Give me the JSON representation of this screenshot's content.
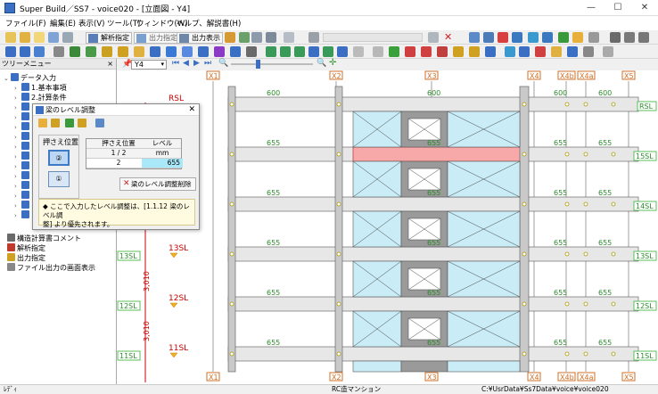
{
  "window": {
    "title": "Super Build／SS7 - voice020 - [立面図 - Y4]",
    "controls": [
      "—",
      "☐",
      "✕"
    ]
  },
  "menu": [
    "ファイル(F)",
    "編集(E)",
    "表示(V)",
    "ツール(T)",
    "ウィンドウ(W)",
    "ヘルプ、解説書(H)"
  ],
  "toolbar1": {
    "analysis_label": "解析指定",
    "output_spec_label": "出力指定",
    "output_display_label": "出力表示"
  },
  "tree": {
    "header": "ツリーメニュー",
    "close": "×",
    "items": [
      "データ入力",
      "1.基本事項",
      "2.計算条件"
    ],
    "bottom_items": [
      "構造計算書コメント",
      "解析指定",
      "出力指定",
      "ファイル出力の画面表示"
    ]
  },
  "level_toolbar": {
    "frame_select": "Y4"
  },
  "grid_labels": {
    "x_axes": [
      "X1",
      "X2",
      "X3",
      "X4",
      "X4b",
      "X4a",
      "X5"
    ]
  },
  "story_labels": [
    "RSL",
    "15SL",
    "14SL",
    "13SL",
    "12SL",
    "11SL"
  ],
  "left_markers": [
    "RSL",
    "14SL",
    "13SL",
    "12SL",
    "11SL"
  ],
  "dimension_text": [
    "3,010",
    "3,010",
    "3,010",
    "3,010"
  ],
  "beam_sizes": [
    "600",
    "655"
  ],
  "dialog": {
    "title": "梁のレベル調整",
    "press_position_label": "押さえ位置",
    "buttons": [
      "②",
      "①"
    ],
    "grid_headers": [
      "押さえ位置",
      "レベル"
    ],
    "grid_sub": [
      "1 / 2",
      "mm"
    ],
    "grid_row": [
      "2",
      "655"
    ],
    "delete_button": "梁のレベル調整削除",
    "note_line1": "◆ ここで入力したレベル調整は、[1.1.12 梁のレベル調",
    "note_line2": "整] より優先されます。"
  },
  "status": {
    "left": "ﾚﾃﾞｨ",
    "center": "RC造マンション",
    "right": "C:¥UsrData¥Ss7Data¥voice¥voice020"
  },
  "colors": {
    "highlight_beam": "#f7a9a9",
    "panel_fill": "#c9ecf6",
    "grid_line": "#5abf5a",
    "story_red": "#cc0000",
    "axis_orange": "#d07028"
  }
}
